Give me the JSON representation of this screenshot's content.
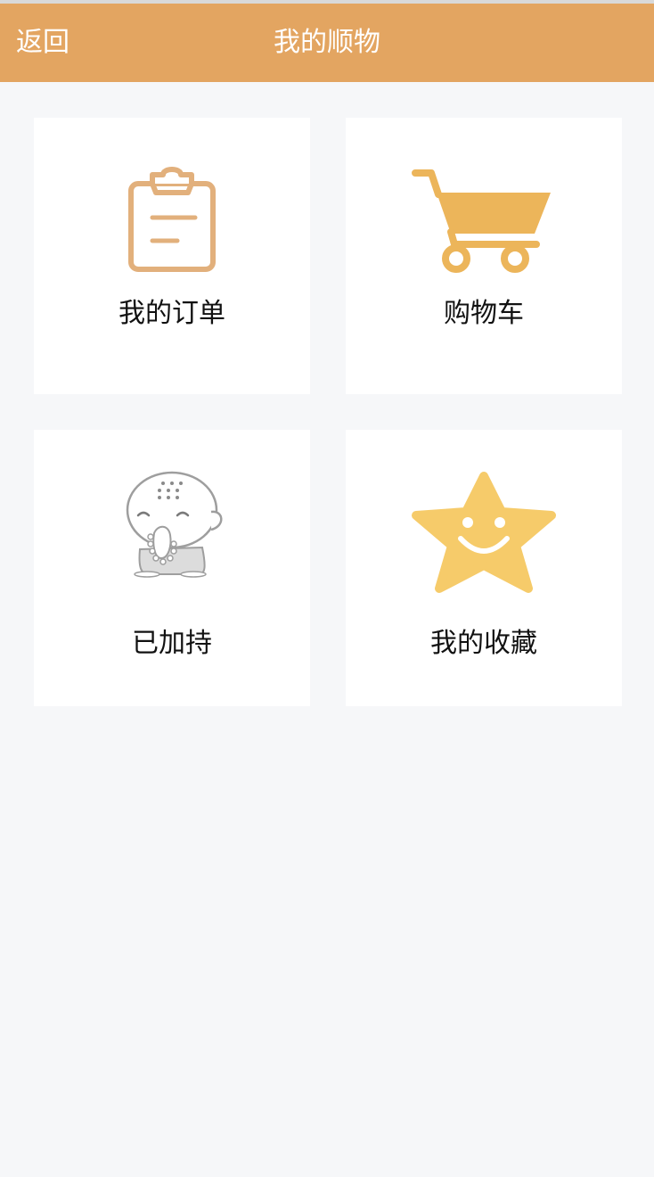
{
  "header": {
    "back_label": "返回",
    "title": "我的顺物"
  },
  "tiles": [
    {
      "label": "我的订单",
      "icon": "clipboard-icon"
    },
    {
      "label": "购物车",
      "icon": "shopping-cart-icon"
    },
    {
      "label": "已加持",
      "icon": "praying-monk-icon"
    },
    {
      "label": "我的收藏",
      "icon": "smiling-star-icon"
    }
  ],
  "colors": {
    "header_bg": "#e3a561",
    "page_bg": "#f6f7f9",
    "clipboard": "#e2b07c",
    "cart": "#ecb55a",
    "star": "#f6cb6a"
  }
}
